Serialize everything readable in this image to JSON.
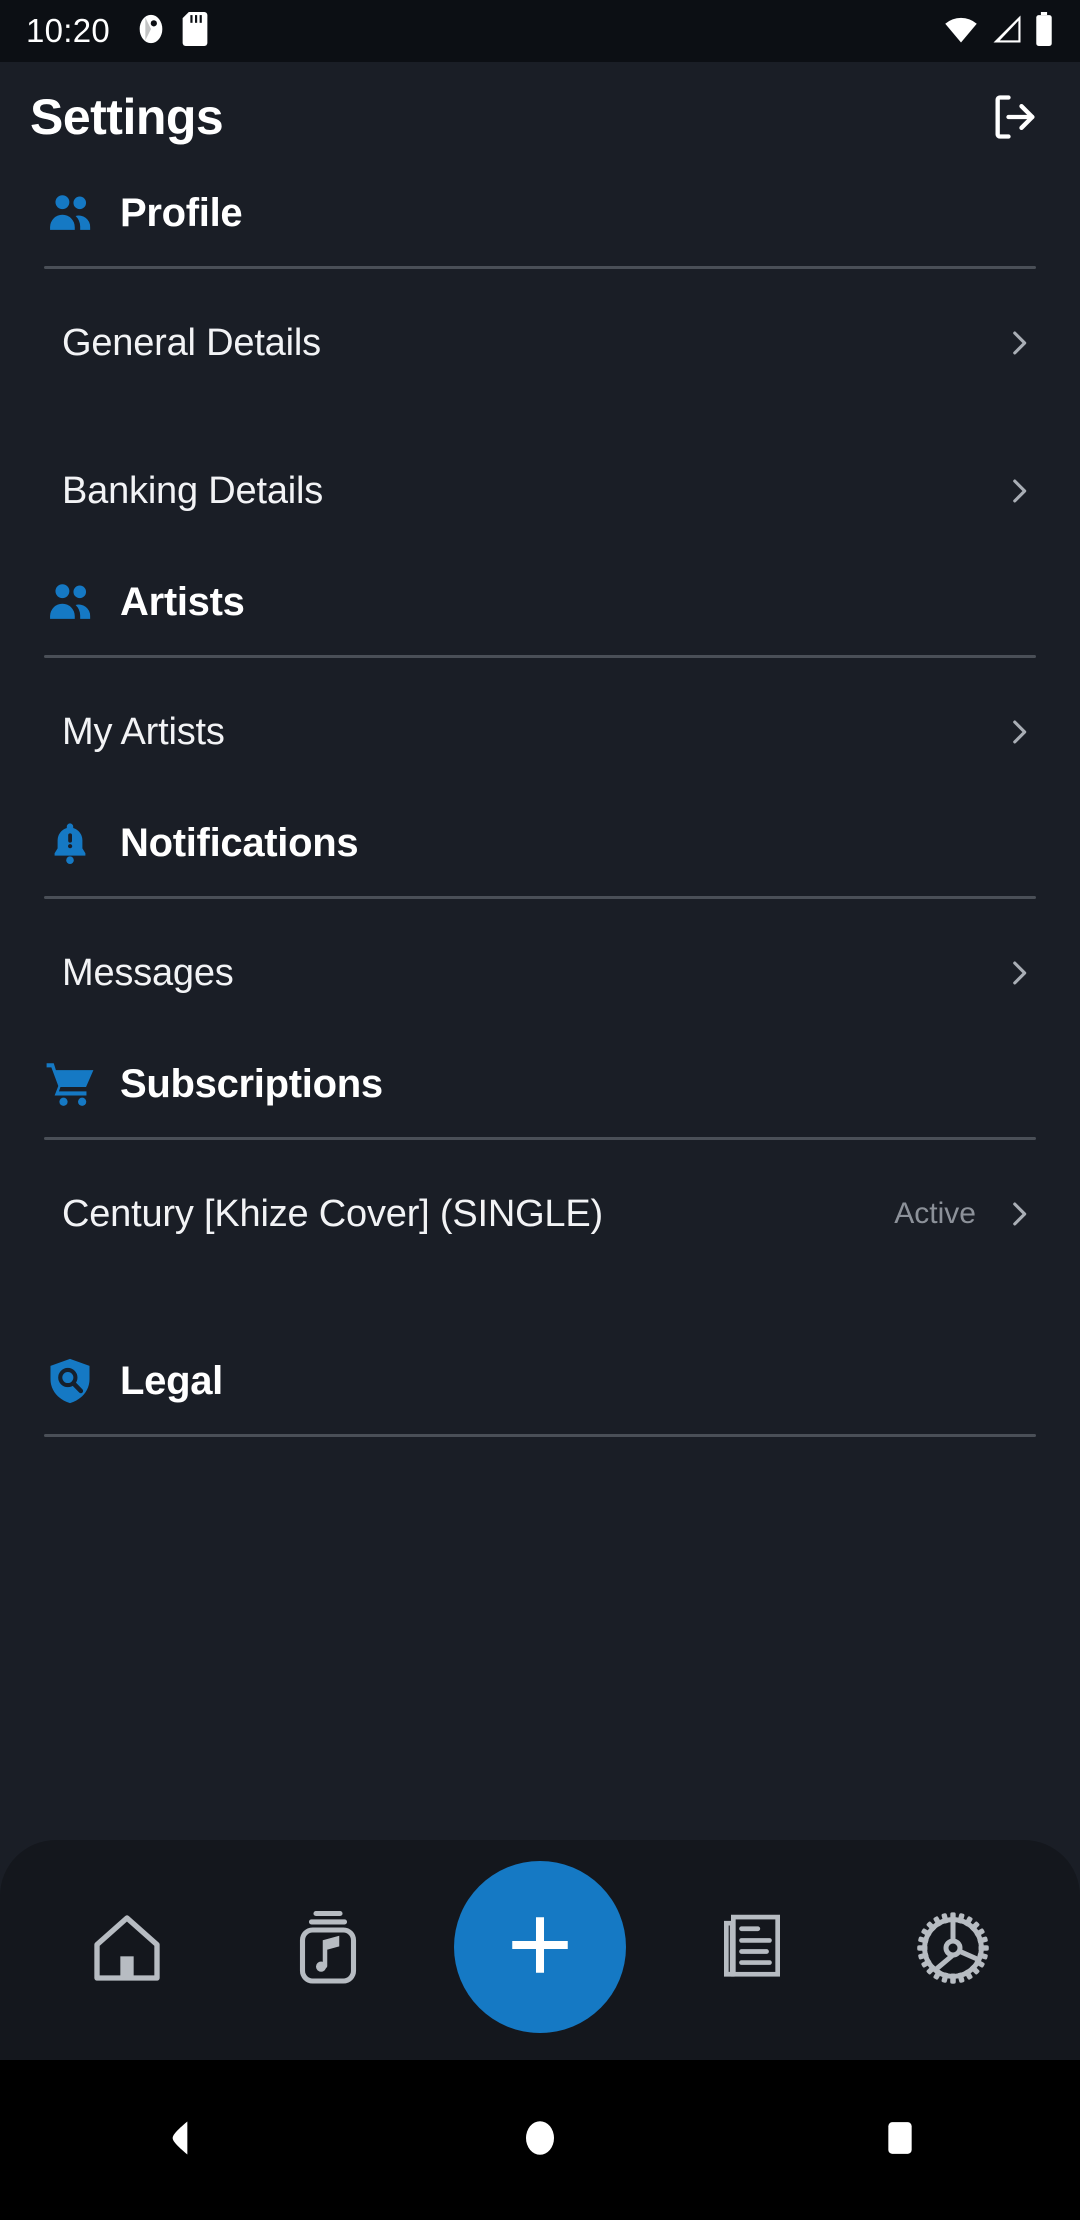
{
  "status_bar": {
    "time": "10:20",
    "left_icons": [
      "app-notification-icon",
      "sd-card-icon"
    ],
    "right_icons": [
      "wifi-icon",
      "cellular-signal-icon",
      "battery-icon"
    ]
  },
  "header": {
    "title": "Settings",
    "logout_icon": "logout-icon"
  },
  "colors": {
    "background": "#1a1e26",
    "status_bar_bg": "#0c0f14",
    "accent": "#1579c4",
    "section_icon": "#1579c4",
    "divider": "#4a4f57",
    "primary_text": "#f2f3f5",
    "muted_text": "#8c9199",
    "bottom_nav_bg": "#14171d",
    "nav_icon": "#b7bcc2"
  },
  "sections": [
    {
      "title": "Profile",
      "icon": "people-icon",
      "items": [
        {
          "label": "General Details",
          "status": "",
          "chevron": "chevron-right-icon"
        },
        {
          "label": "Banking Details",
          "status": "",
          "chevron": "chevron-right-icon"
        }
      ]
    },
    {
      "title": "Artists",
      "icon": "people-icon",
      "items": [
        {
          "label": "My Artists",
          "status": "",
          "chevron": "chevron-right-icon"
        }
      ]
    },
    {
      "title": "Notifications",
      "icon": "bell-alert-icon",
      "items": [
        {
          "label": "Messages",
          "status": "",
          "chevron": "chevron-right-icon"
        }
      ]
    },
    {
      "title": "Subscriptions",
      "icon": "shopping-cart-icon",
      "items": [
        {
          "label": "Century [Khize Cover] (SINGLE)",
          "status": "Active",
          "chevron": "chevron-right-icon"
        }
      ]
    },
    {
      "title": "Legal",
      "icon": "shield-search-icon",
      "items": []
    }
  ],
  "bottom_nav": {
    "items": [
      {
        "name": "home",
        "icon": "home-icon"
      },
      {
        "name": "music-library",
        "icon": "music-album-icon"
      },
      {
        "name": "create",
        "icon": "plus-icon"
      },
      {
        "name": "releases",
        "icon": "document-list-icon"
      },
      {
        "name": "settings",
        "icon": "gear-icon"
      }
    ]
  },
  "android_nav": {
    "back": "back-triangle-icon",
    "home": "home-circle-icon",
    "recents": "recents-square-icon"
  }
}
